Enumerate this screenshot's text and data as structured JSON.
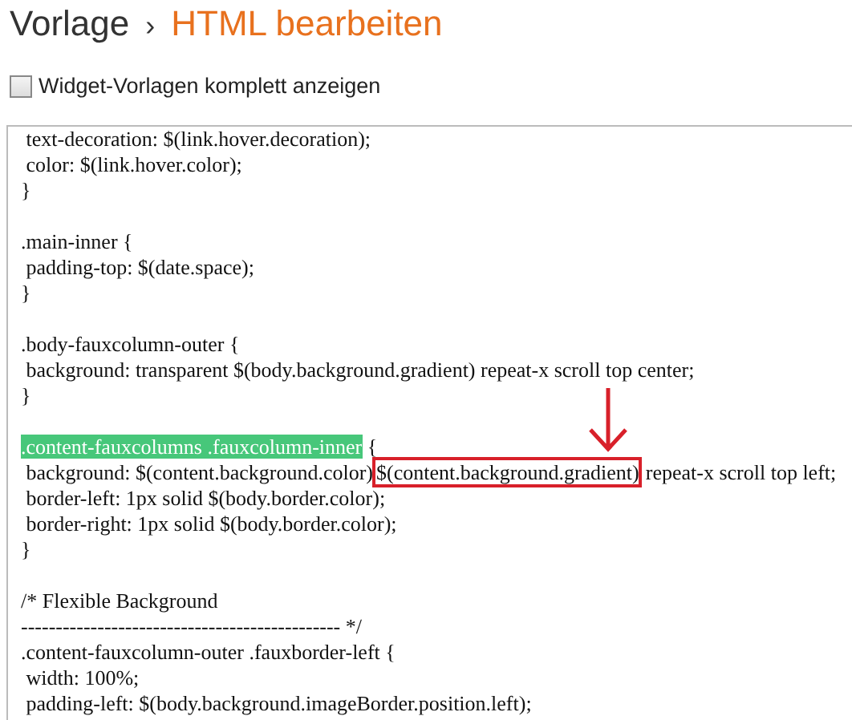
{
  "breadcrumb": {
    "parent": "Vorlage",
    "separator": "›",
    "current": "HTML bearbeiten"
  },
  "widget_toggle": {
    "label": "Widget-Vorlagen komplett anzeigen",
    "checked": false
  },
  "editor": {
    "blocks": [
      [
        [
          {
            "kind": "plain",
            "text": " text-decoration: $(link.hover.decoration);"
          }
        ],
        [
          {
            "kind": "plain",
            "text": " color: $(link.hover.color);"
          }
        ],
        [
          {
            "kind": "plain",
            "text": "}"
          }
        ]
      ],
      [
        [
          {
            "kind": "plain",
            "text": ".main-inner {"
          }
        ],
        [
          {
            "kind": "plain",
            "text": " padding-top: $(date.space);"
          }
        ],
        [
          {
            "kind": "plain",
            "text": "}"
          }
        ]
      ],
      [
        [
          {
            "kind": "plain",
            "text": ".body-fauxcolumn-outer {"
          }
        ],
        [
          {
            "kind": "plain",
            "text": " background: transparent $(body.background.gradient) repeat-x scroll top center;"
          }
        ],
        [
          {
            "kind": "plain",
            "text": "}"
          }
        ]
      ],
      [
        [
          {
            "kind": "highlight",
            "text": ".content-fauxcolumns .fauxcolumn-inner"
          },
          {
            "kind": "plain",
            "text": " {"
          }
        ],
        [
          {
            "kind": "plain",
            "text": " background: $(content.background.color)"
          },
          {
            "kind": "boxed",
            "text": "$(content.background.gradient)"
          },
          {
            "kind": "plain",
            "text": "repeat-x scroll top left;"
          }
        ],
        [
          {
            "kind": "plain",
            "text": " border-left: 1px solid $(body.border.color);"
          }
        ],
        [
          {
            "kind": "plain",
            "text": " border-right: 1px solid $(body.border.color);"
          }
        ],
        [
          {
            "kind": "plain",
            "text": "}"
          }
        ]
      ],
      [
        [
          {
            "kind": "plain",
            "text": "/* Flexible Background"
          }
        ],
        [
          {
            "kind": "plain",
            "text": "---------------------------------------------- */"
          }
        ],
        [
          {
            "kind": "plain",
            "text": ".content-fauxcolumn-outer .fauxborder-left {"
          }
        ],
        [
          {
            "kind": "plain",
            "text": " width: 100%;"
          }
        ],
        [
          {
            "kind": "plain",
            "text": " padding-left: $(body.background.imageBorder.position.left);"
          }
        ]
      ]
    ]
  }
}
